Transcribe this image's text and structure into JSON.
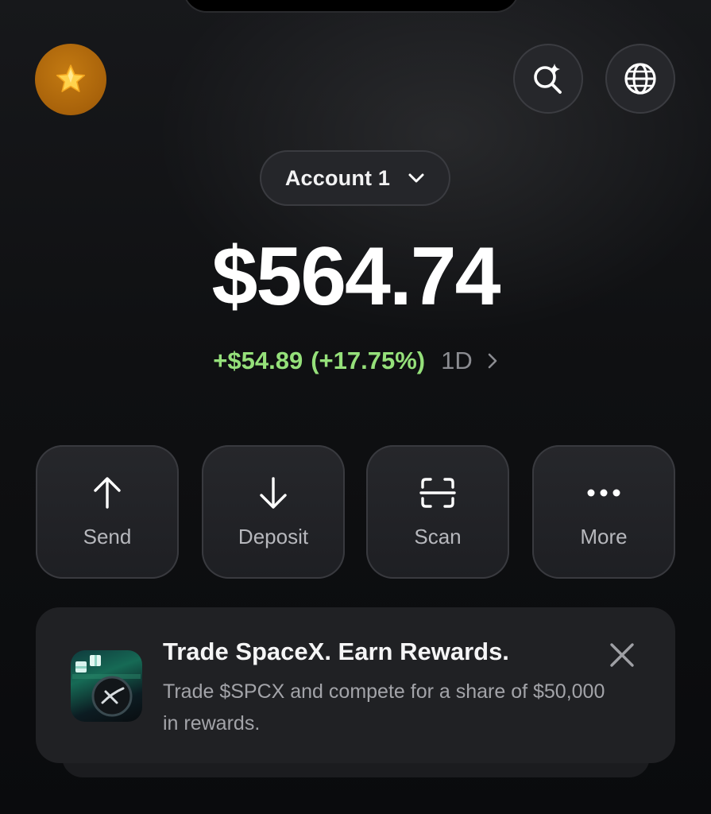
{
  "header": {
    "avatar_icon": "star-icon",
    "avatar_color": "#b06a0d",
    "search_icon": "sparkle-search-icon",
    "globe_icon": "globe-icon"
  },
  "account": {
    "label": "Account 1",
    "dropdown_icon": "chevron-down-icon"
  },
  "portfolio": {
    "balance": "$564.74",
    "change_amount": "+$54.89",
    "change_percent": "(+17.75%)",
    "period": "1D",
    "positive_color": "#95e07a"
  },
  "actions": [
    {
      "label": "Send",
      "icon": "arrow-up-icon"
    },
    {
      "label": "Deposit",
      "icon": "arrow-down-icon"
    },
    {
      "label": "Scan",
      "icon": "scan-icon"
    },
    {
      "label": "More",
      "icon": "more-dots-icon"
    }
  ],
  "promo": {
    "title": "Trade SpaceX. Earn Rewards.",
    "description": "Trade $SPCX and compete for a share of $50,000 in rewards.",
    "close_icon": "close-icon"
  }
}
